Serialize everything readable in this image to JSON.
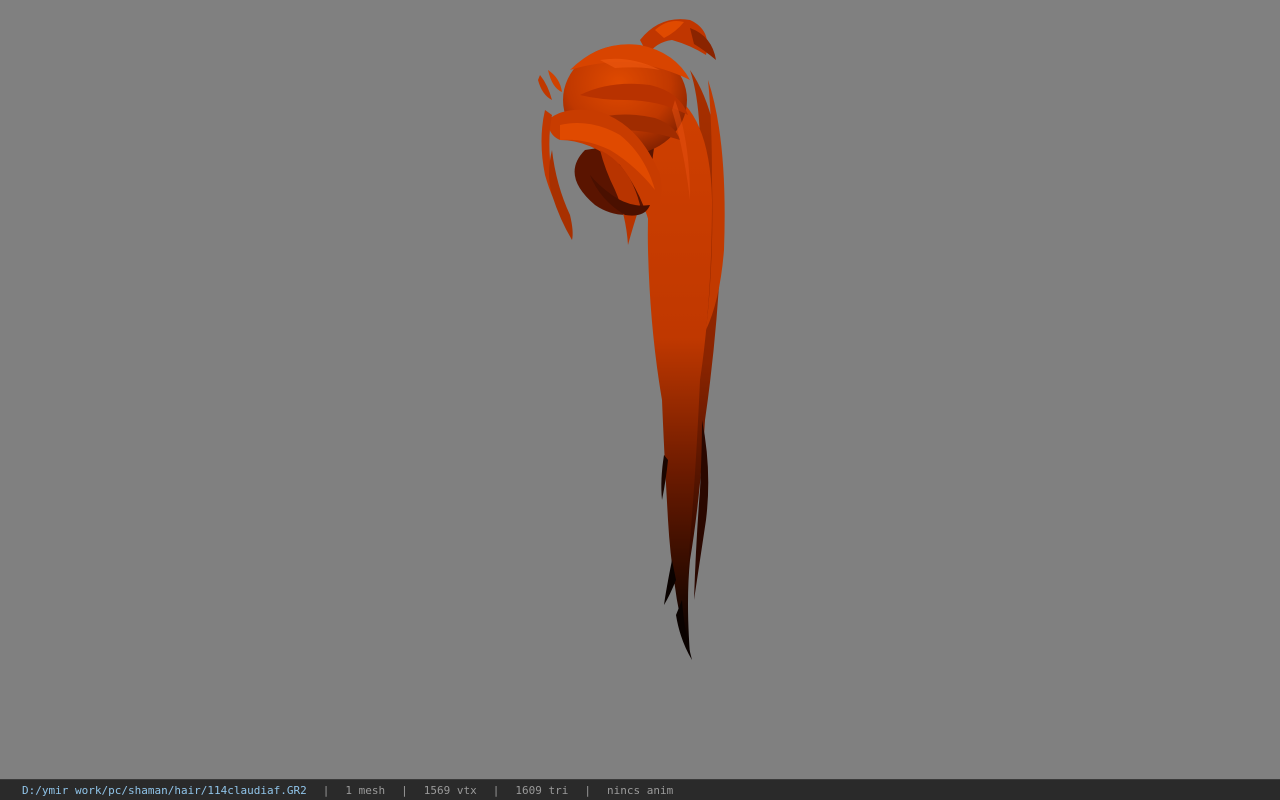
{
  "viewer": {
    "background_color": "#808080",
    "model": {
      "name": "hair-model",
      "primary_color": "#cc3a00",
      "shade_color": "#7a1e00",
      "tip_color": "#0a0200"
    }
  },
  "status_bar": {
    "file_path": "D:/ymir work/pc/shaman/hair/114claudiaf.GR2",
    "separator": "|",
    "mesh_count": "1 mesh",
    "vertex_count": "1569 vtx",
    "triangle_count": "1609 tri",
    "anim_status": "nincs anim"
  }
}
